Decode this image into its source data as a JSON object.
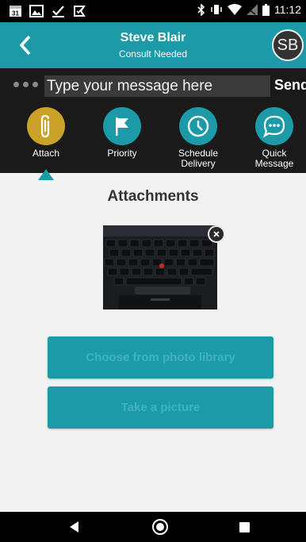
{
  "status_bar": {
    "time": "11:12",
    "left_icons": [
      "calendar-icon",
      "gallery-icon",
      "checkmark-icon",
      "flag-check-icon"
    ],
    "right_icons": [
      "bluetooth-icon",
      "vibrate-icon",
      "wifi-icon",
      "signal-icon",
      "battery-icon"
    ],
    "calendar_day": "31"
  },
  "header": {
    "title": "Steve Blair",
    "subtitle": "Consult Needed",
    "avatar_initials": "SB",
    "accent_color": "#1c9aa8"
  },
  "message_bar": {
    "placeholder": "Type your message here",
    "send_label": "Send"
  },
  "actions": [
    {
      "label": "Attach",
      "icon": "paperclip-icon",
      "active": true
    },
    {
      "label": "Priority",
      "icon": "flag-icon",
      "active": false
    },
    {
      "label": "Schedule\nDelivery",
      "label_line1": "Schedule",
      "label_line2": "Delivery",
      "icon": "clock-icon",
      "active": false
    },
    {
      "label": "Quick\nMessage",
      "label_line1": "Quick",
      "label_line2": "Message",
      "icon": "chat-bubble-icon",
      "active": false
    }
  ],
  "attachments": {
    "title": "Attachments",
    "photo": "keyboard-photo",
    "buttons": {
      "choose_label": "Choose from photo library",
      "take_label": "Take a picture"
    }
  },
  "nav_bar": {
    "icons": [
      "back-icon",
      "home-icon",
      "recents-icon"
    ]
  }
}
